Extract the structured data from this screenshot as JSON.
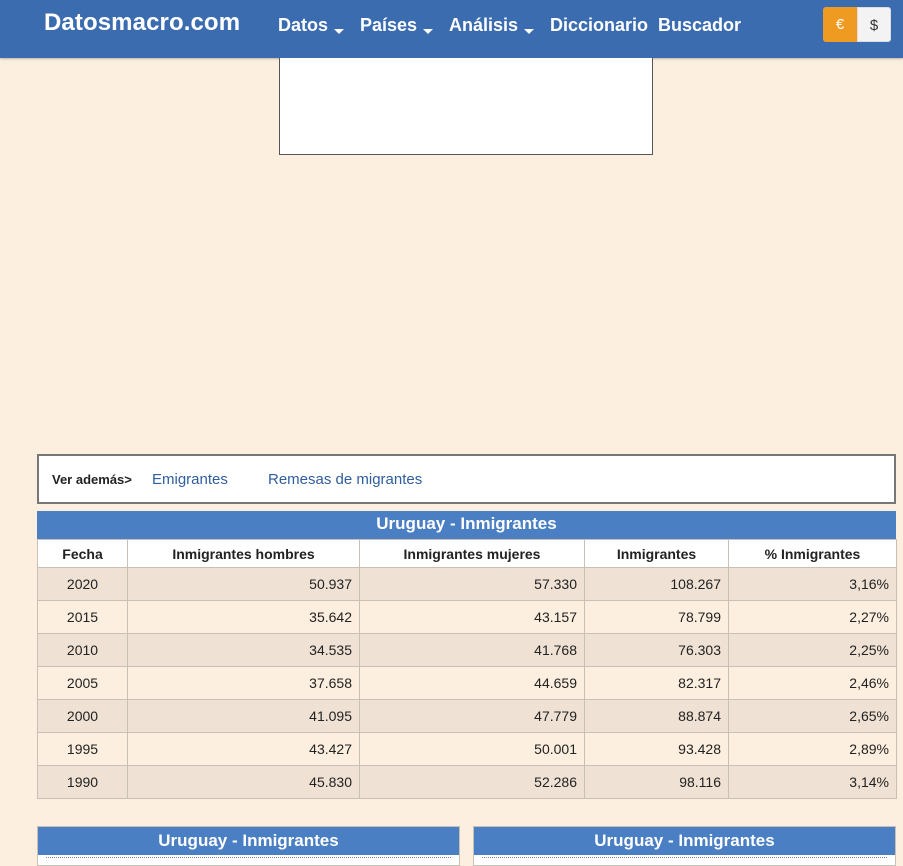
{
  "nav": {
    "brand": "Datosmacro.com",
    "items": [
      {
        "label": "Datos",
        "dropdown": true
      },
      {
        "label": "Países",
        "dropdown": true
      },
      {
        "label": "Análisis",
        "dropdown": true
      },
      {
        "label": "Diccionario",
        "dropdown": false
      },
      {
        "label": "Buscador",
        "dropdown": false
      }
    ],
    "currency": {
      "eur": "€",
      "usd": "$",
      "selected": "eur"
    }
  },
  "see_also": {
    "label": "Ver además>",
    "links": [
      "Emigrantes",
      "Remesas de migrantes"
    ]
  },
  "table": {
    "title": "Uruguay - Inmigrantes",
    "columns": [
      "Fecha",
      "Inmigrantes hombres",
      "Inmigrantes mujeres",
      "Inmigrantes",
      "% Inmigrantes"
    ],
    "rows": [
      [
        "2020",
        "50.937",
        "57.330",
        "108.267",
        "3,16%"
      ],
      [
        "2015",
        "35.642",
        "43.157",
        "78.799",
        "2,27%"
      ],
      [
        "2010",
        "34.535",
        "41.768",
        "76.303",
        "2,25%"
      ],
      [
        "2005",
        "37.658",
        "44.659",
        "82.317",
        "2,46%"
      ],
      [
        "2000",
        "41.095",
        "47.779",
        "88.874",
        "2,65%"
      ],
      [
        "1995",
        "43.427",
        "50.001",
        "93.428",
        "2,89%"
      ],
      [
        "1990",
        "45.830",
        "52.286",
        "98.116",
        "3,14%"
      ]
    ]
  },
  "panels": {
    "left_title": "Uruguay - Inmigrantes",
    "right_title": "Uruguay - Inmigrantes"
  },
  "colors": {
    "nav_bg": "#3b6cb0",
    "title_bg": "#4a7fc3",
    "page_bg": "#fdefdf",
    "eur_active": "#ef9b21",
    "link": "#2f5d9e"
  }
}
